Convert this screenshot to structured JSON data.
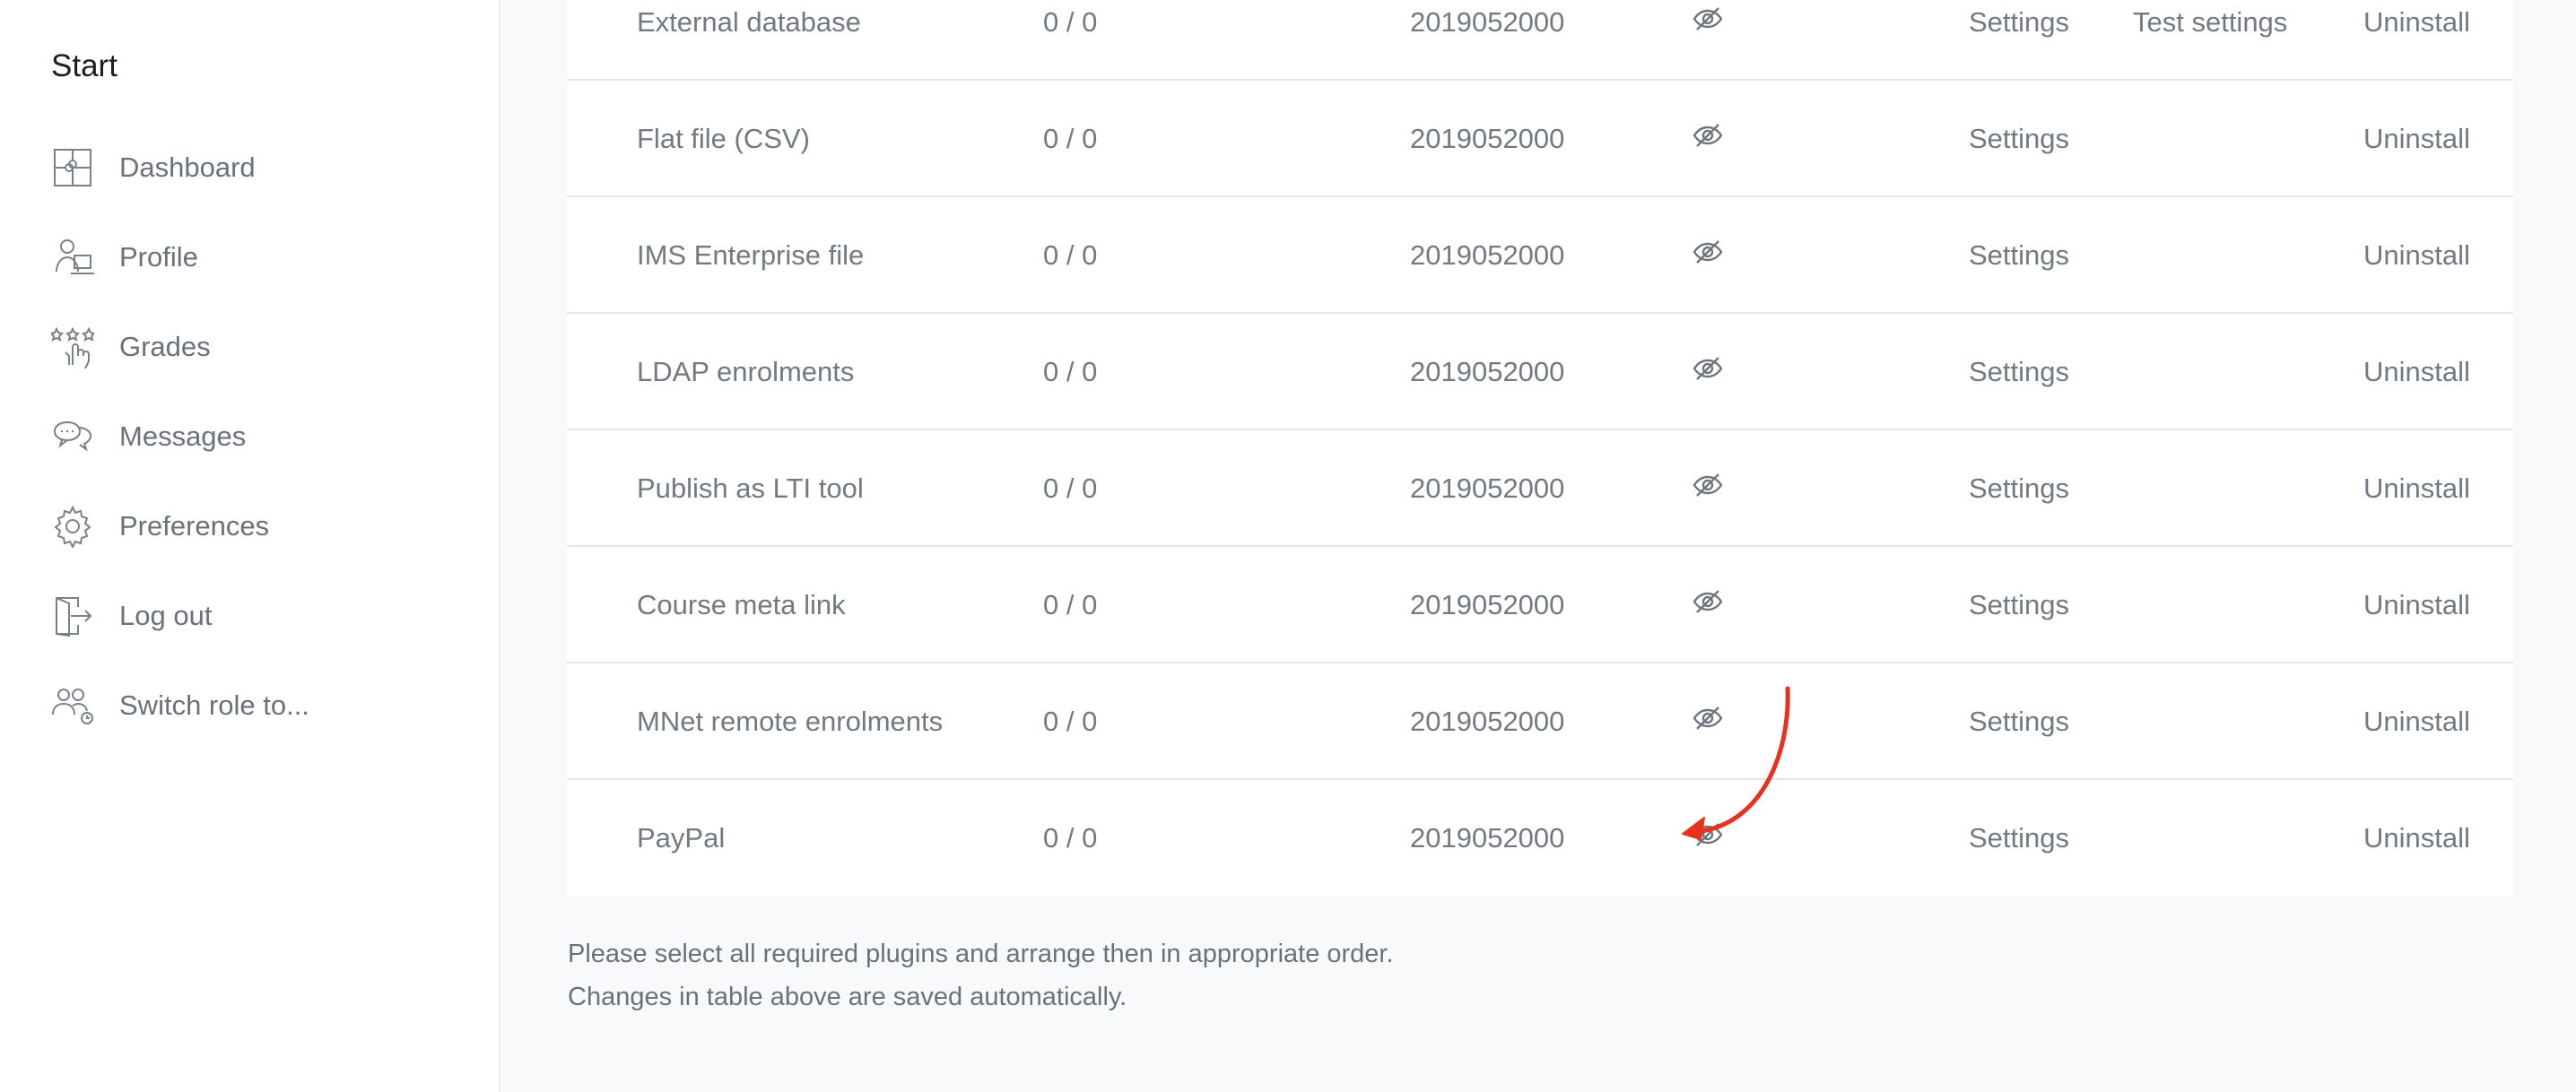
{
  "sidebar": {
    "title": "Start",
    "items": [
      {
        "label": "Dashboard",
        "icon": "puzzle-icon"
      },
      {
        "label": "Profile",
        "icon": "user-icon"
      },
      {
        "label": "Grades",
        "icon": "grades-icon"
      },
      {
        "label": "Messages",
        "icon": "chat-icon"
      },
      {
        "label": "Preferences",
        "icon": "gear-icon"
      },
      {
        "label": "Log out",
        "icon": "logout-icon"
      },
      {
        "label": "Switch role to...",
        "icon": "switch-role-icon"
      }
    ]
  },
  "plugins": {
    "rows": [
      {
        "name": "External database",
        "count": "0 / 0",
        "version": "2019052000",
        "settings": "Settings",
        "test": "Test settings",
        "uninstall": "Uninstall"
      },
      {
        "name": "Flat file (CSV)",
        "count": "0 / 0",
        "version": "2019052000",
        "settings": "Settings",
        "test": "",
        "uninstall": "Uninstall"
      },
      {
        "name": "IMS Enterprise file",
        "count": "0 / 0",
        "version": "2019052000",
        "settings": "Settings",
        "test": "",
        "uninstall": "Uninstall"
      },
      {
        "name": "LDAP enrolments",
        "count": "0 / 0",
        "version": "2019052000",
        "settings": "Settings",
        "test": "",
        "uninstall": "Uninstall"
      },
      {
        "name": "Publish as LTI tool",
        "count": "0 / 0",
        "version": "2019052000",
        "settings": "Settings",
        "test": "",
        "uninstall": "Uninstall"
      },
      {
        "name": "Course meta link",
        "count": "0 / 0",
        "version": "2019052000",
        "settings": "Settings",
        "test": "",
        "uninstall": "Uninstall"
      },
      {
        "name": "MNet remote enrolments",
        "count": "0 / 0",
        "version": "2019052000",
        "settings": "Settings",
        "test": "",
        "uninstall": "Uninstall"
      },
      {
        "name": "PayPal",
        "count": "0 / 0",
        "version": "2019052000",
        "settings": "Settings",
        "test": "",
        "uninstall": "Uninstall"
      }
    ]
  },
  "notes": {
    "line1": "Please select all required plugins and arrange then in appropriate order.",
    "line2": "Changes in table above are saved automatically."
  },
  "colors": {
    "accent_arrow": "#e8321f",
    "text_muted": "#737980",
    "background": "#f8f9fa"
  }
}
